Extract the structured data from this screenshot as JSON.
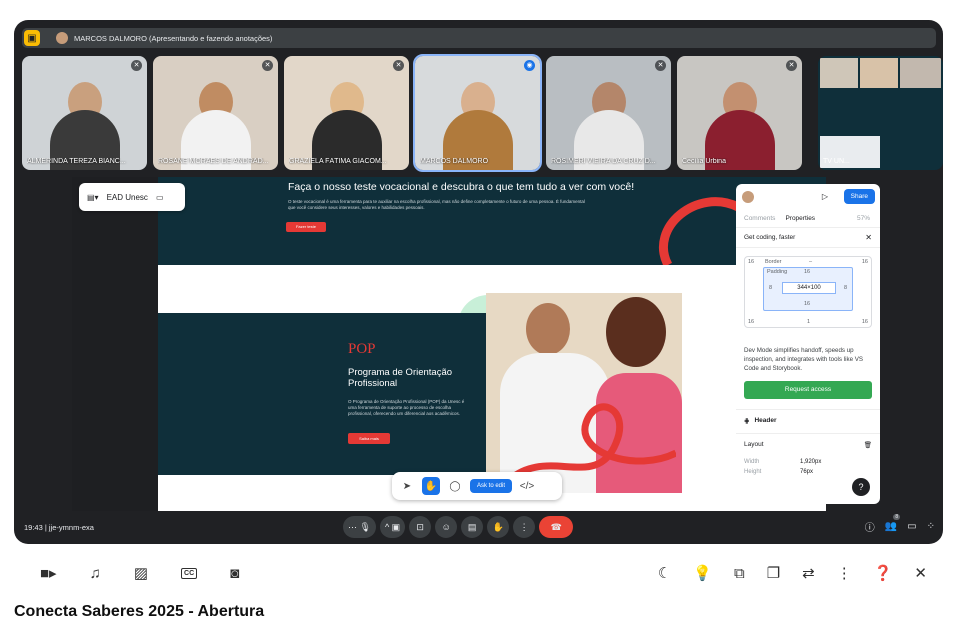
{
  "meet": {
    "presenter_text": "MARCOS DALMORO (Apresentando e fazendo anotações)",
    "participants": [
      {
        "name": "ALMERINDA TEREZA BIANC...",
        "active": false
      },
      {
        "name": "ROSANE MORAES DE ANDRAD...",
        "active": false
      },
      {
        "name": "GRAZIELA FÁTIMA GIACOM...",
        "active": false
      },
      {
        "name": "MARCOS DALMORO",
        "active": true
      },
      {
        "name": "ROSIMERI VIEIRA DA CRUZ D...",
        "active": false
      },
      {
        "name": "Cecília Urbina",
        "active": false
      }
    ],
    "grid_tile_name": "TV UN..."
  },
  "shared": {
    "hero_title": "Faça o nosso teste vocacional e descubra o que tem tudo a ver com você!",
    "hero_desc": "O teste vocacional é uma ferramenta para te auxiliar na escolha profissional, mas não define completamente o futuro de uma pessoa. É fundamental que você considere seus interesses, valores e habilidades pessoais.",
    "hero_btn": "Fazer teste",
    "toolbar_title": "EAD Unesc",
    "pop_title": "POP",
    "pop_subtitle": "Programa de Orientação Profissional",
    "pop_desc": "O Programa de Orientação Profissional (POP) da Unesc é uma ferramenta de suporte ao processo de escolha profissional, oferecendo um diferencial aos acadêmicos.",
    "pop_btn": "Saiba mais",
    "ask_to_edit": "Ask to edit"
  },
  "panel": {
    "share": "Share",
    "tab_comments": "Comments",
    "tab_properties": "Properties",
    "zoom": "57%",
    "banner": "Get coding, faster",
    "border_label": "Border",
    "border_value": "–",
    "padding_label": "Padding",
    "outer_top_left": "16",
    "outer_top_right": "16",
    "outer_bottom_left": "16",
    "outer_bottom_mid": "1",
    "outer_bottom_right": "16",
    "pad_top": "16",
    "pad_left": "8",
    "pad_right": "8",
    "pad_bottom": "16",
    "content_size": "344×100",
    "desc": "Dev Mode simplifies handoff, speeds up inspection, and integrates with tools like VS Code and Storybook.",
    "request_access": "Request access",
    "header_section": "Header",
    "layout_section": "Layout",
    "width_label": "Width",
    "width_value": "1,920px",
    "height_label": "Height",
    "height_value": "76px",
    "help": "?"
  },
  "controls": {
    "clock": "19:43",
    "meeting_code": "jje-ymnm-exa",
    "people_count": "8"
  },
  "youtube": {
    "title": "Conecta Saberes 2025 - Abertura",
    "cc_label": "CC"
  }
}
